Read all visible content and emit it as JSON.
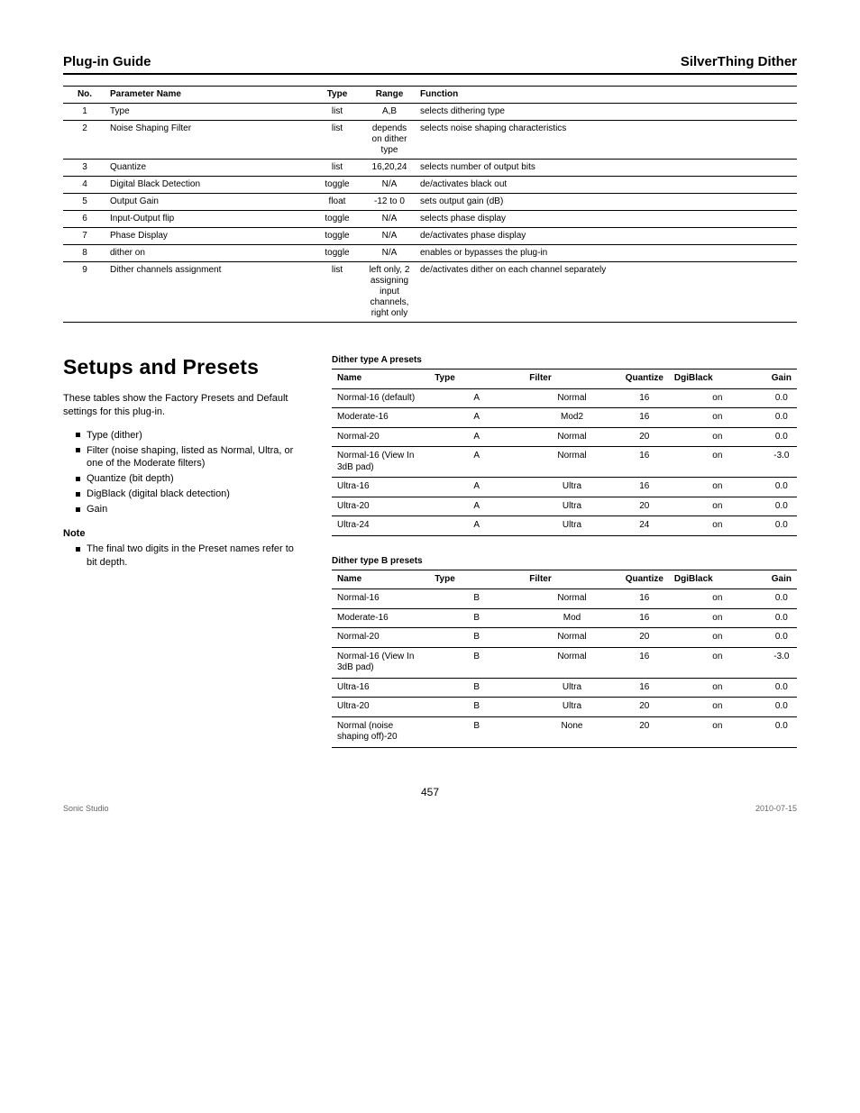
{
  "header": {
    "left": "Plug-in Guide",
    "right": "SilverThing Dither"
  },
  "params_table": {
    "headers": [
      "No.",
      "Parameter Name",
      "Type",
      "Range",
      "Function"
    ],
    "rows": [
      [
        "1",
        "Type",
        "list",
        "A,B",
        "selects dithering type"
      ],
      [
        "2",
        "Noise Shaping Filter",
        "list",
        "depends on dither type",
        "selects noise shaping characteristics"
      ],
      [
        "3",
        "Quantize",
        "list",
        "16,20,24",
        "selects number of output bits"
      ],
      [
        "4",
        "Digital Black Detection",
        "toggle",
        "N/A",
        "de/activates black out"
      ],
      [
        "5",
        "Output Gain",
        "float",
        "-12 to 0",
        "sets output gain (dB)"
      ],
      [
        "6",
        "Input-Output flip",
        "toggle",
        "N/A",
        "selects phase display"
      ],
      [
        "7",
        "Phase Display",
        "toggle",
        "N/A",
        "de/activates phase display"
      ],
      [
        "8",
        "dither on",
        "toggle",
        "N/A",
        "enables or bypasses the plug-in"
      ],
      [
        "9",
        "Dither channels assignment",
        "list",
        "left only, 2 assigning input channels, right only",
        "de/activates dither on each channel separately"
      ]
    ]
  },
  "section": {
    "title": "Setups and Presets",
    "intro": "These tables show the Factory Presets and Default settings for this plug-in.",
    "bullets": [
      "Type (dither)",
      "Filter (noise shaping, listed as Normal, Ultra, or one of the Moderate filters)",
      "Quantize (bit depth)",
      "DigBlack (digital black detection)",
      "Gain"
    ],
    "note_heading": "Note",
    "note_bullet": "The final two digits in the Preset names refer to bit depth."
  },
  "table_a": {
    "caption": "Dither type A presets",
    "headers": [
      "Name",
      "Type",
      "Filter",
      "Quantize",
      "DgiBlack",
      "Gain"
    ],
    "rows": [
      [
        "Normal-16 (default)",
        "A",
        "Normal",
        "16",
        "on",
        "0.0"
      ],
      [
        "Moderate-16",
        "A",
        "Mod2",
        "16",
        "on",
        "0.0"
      ],
      [
        "Normal-20",
        "A",
        "Normal",
        "20",
        "on",
        "0.0"
      ],
      [
        "Normal-16 (View In 3dB pad)",
        "A",
        "Normal",
        "16",
        "on",
        "-3.0"
      ],
      [
        "Ultra-16",
        "A",
        "Ultra",
        "16",
        "on",
        "0.0"
      ],
      [
        "Ultra-20",
        "A",
        "Ultra",
        "20",
        "on",
        "0.0"
      ],
      [
        "Ultra-24",
        "A",
        "Ultra",
        "24",
        "on",
        "0.0"
      ]
    ]
  },
  "table_b": {
    "caption": "Dither type B presets",
    "headers": [
      "Name",
      "Type",
      "Filter",
      "Quantize",
      "DgiBlack",
      "Gain"
    ],
    "rows": [
      [
        "Normal-16",
        "B",
        "Normal",
        "16",
        "on",
        "0.0"
      ],
      [
        "Moderate-16",
        "B",
        "Mod",
        "16",
        "on",
        "0.0"
      ],
      [
        "Normal-20",
        "B",
        "Normal",
        "20",
        "on",
        "0.0"
      ],
      [
        "Normal-16 (View In 3dB pad)",
        "B",
        "Normal",
        "16",
        "on",
        "-3.0"
      ],
      [
        "Ultra-16",
        "B",
        "Ultra",
        "16",
        "on",
        "0.0"
      ],
      [
        "Ultra-20",
        "B",
        "Ultra",
        "20",
        "on",
        "0.0"
      ],
      [
        "Normal (noise shaping off)-20",
        "B",
        "None",
        "20",
        "on",
        "0.0"
      ]
    ]
  },
  "footer": {
    "page": "457",
    "left": "Sonic Studio",
    "right": "2010-07-15"
  }
}
